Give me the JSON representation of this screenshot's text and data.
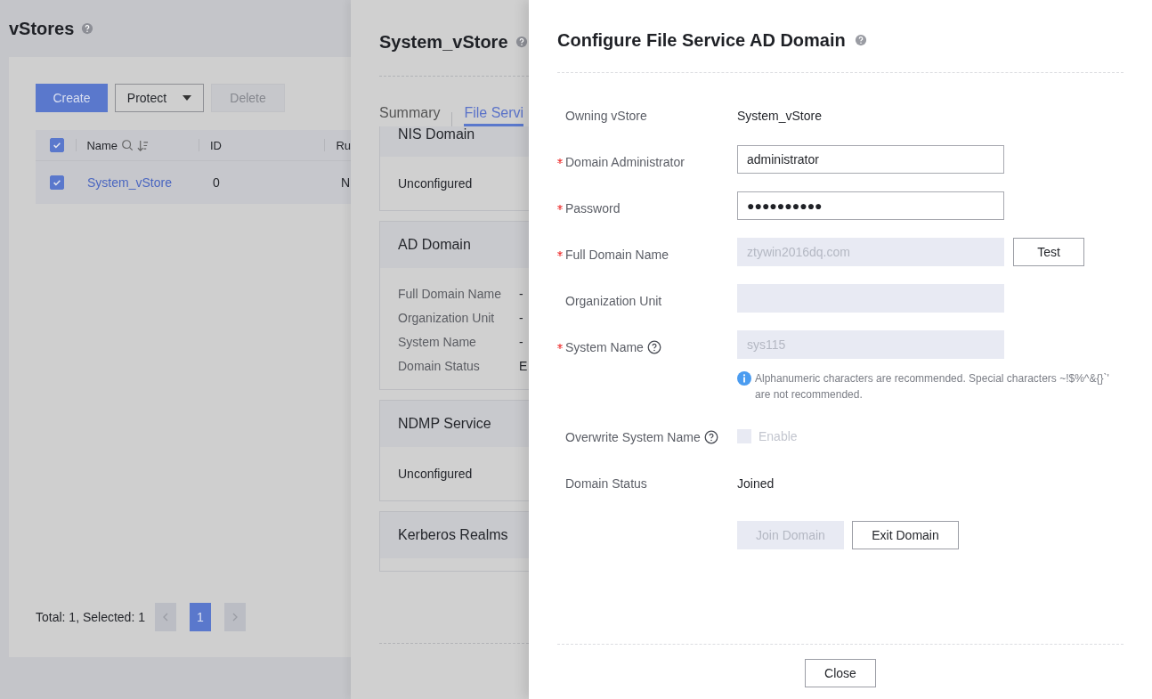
{
  "page": {
    "title": "vStores",
    "help": true,
    "toolbar": [
      {
        "label": "Create",
        "kind": "primary"
      },
      {
        "label": "Protect",
        "kind": "dropdown"
      },
      {
        "label": "Delete",
        "kind": "disabled"
      }
    ],
    "table": {
      "header_checked": true,
      "columns": [
        {
          "label": "Name",
          "tools": true
        },
        {
          "label": "ID",
          "tools": false
        },
        {
          "label": "Ru",
          "tools": false
        }
      ],
      "rows": [
        {
          "checked": true,
          "cells": [
            "System_vStore",
            "0",
            "N"
          ]
        }
      ]
    },
    "pagination": {
      "summary": "Total: 1, Selected: 1",
      "pages": [
        {
          "label": "1",
          "selected": true
        }
      ]
    }
  },
  "detail": {
    "title": "System_vStore",
    "help": true,
    "tabs": [
      {
        "label": "Summary",
        "selected": false
      },
      {
        "label": "File Servi",
        "selected": true
      }
    ],
    "sections": [
      {
        "title": "NIS Domain",
        "kind": "status",
        "status": "Unconfigured",
        "scrolled": true
      },
      {
        "title": "AD Domain",
        "kind": "fields",
        "scrolled": false,
        "fields": [
          {
            "label": "Full Domain Name",
            "value": "-"
          },
          {
            "label": "Organization Unit",
            "value": "-"
          },
          {
            "label": "System Name",
            "value": "-"
          },
          {
            "label": "Domain Status",
            "value": "E"
          }
        ]
      },
      {
        "title": "NDMP Service",
        "kind": "status",
        "status": "Unconfigured",
        "scrolled": false
      },
      {
        "title": "Kerberos Realms",
        "kind": "header",
        "scrolled": false
      }
    ]
  },
  "dialog": {
    "title": "Configure File Service AD Domain",
    "help": true,
    "fields": [
      {
        "kind": "text",
        "label": "Owning vStore",
        "required": false,
        "value": "System_vStore"
      },
      {
        "kind": "input",
        "label": "Domain Administrator",
        "required": true,
        "value": "administrator",
        "disabled": false
      },
      {
        "kind": "input",
        "label": "Password",
        "required": true,
        "value": "●●●●●●●●●●",
        "disabled": false
      },
      {
        "kind": "input",
        "label": "Full Domain Name",
        "required": true,
        "value": "ztywin2016dq.com",
        "disabled": true,
        "button": "Test"
      },
      {
        "kind": "input",
        "label": "Organization Unit",
        "required": false,
        "disabled": true
      },
      {
        "kind": "input",
        "label": "System Name",
        "required": true,
        "help": true,
        "value": "sys115",
        "disabled": true,
        "hint": "Alphanumeric characters are recommended. Special characters ~!$%^&{}`' are not recommended."
      },
      {
        "kind": "checkbox",
        "label": "Overwrite System Name",
        "required": false,
        "help": true,
        "option": "Enable",
        "checked": false,
        "disabled": true
      },
      {
        "kind": "text",
        "label": "Domain Status",
        "required": false,
        "value": "Joined"
      }
    ],
    "actions": [
      {
        "label": "Join Domain",
        "disabled": true
      },
      {
        "label": "Exit Domain",
        "disabled": false
      }
    ],
    "footer_button": "Close"
  }
}
